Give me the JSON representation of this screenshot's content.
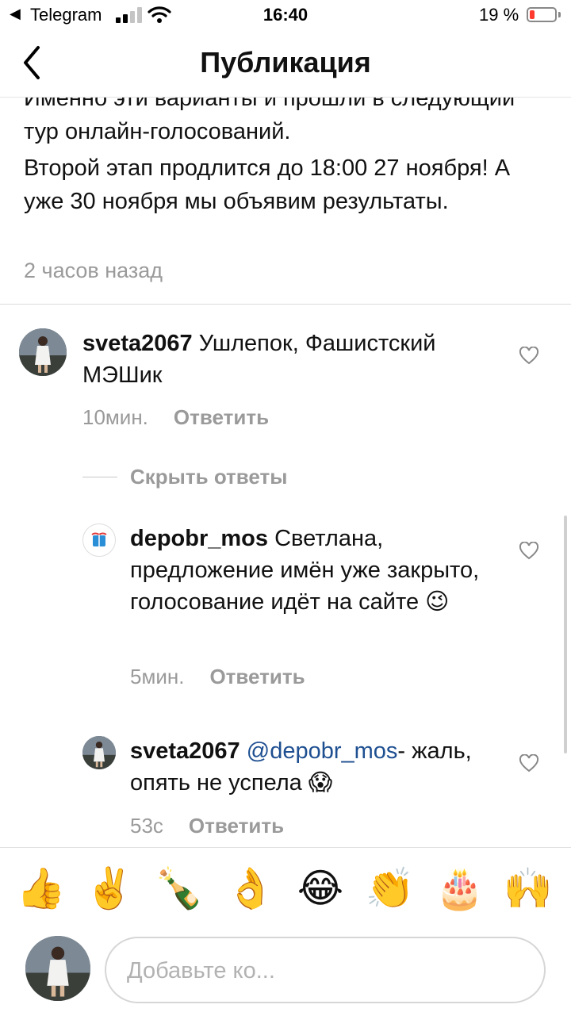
{
  "status_bar": {
    "back_arrow": "◀",
    "app": "Telegram",
    "time": "16:40",
    "battery": "19 %",
    "battery_level": 0.19,
    "battery_color": "#ff3b30"
  },
  "nav": {
    "title": "Публикация",
    "back_icon": "chevron-left-icon"
  },
  "post": {
    "caption_line1": "Именно эти варианты и прошли в следующий тур онлайн-голосований.",
    "caption_line2": "Второй этап продлится до 18:00 27 ноября! А уже 30 ноября мы объявим результаты.",
    "time": "2 часов назад"
  },
  "comments": [
    {
      "username": "sveta2067",
      "text": "Ушлепок, Фашистский МЭШик",
      "time": "10мин.",
      "reply_label": "Ответить"
    }
  ],
  "hide_replies_label": "Скрыть ответы",
  "replies": [
    {
      "username": "depobr_mos",
      "text": "Светлана, предложение имён уже закрыто, голосование идёт на сайте",
      "emoji": "😉",
      "time": "5мин.",
      "reply_label": "Ответить"
    },
    {
      "username": "sveta2067",
      "mention": "@depobr_mos",
      "text": "- жаль, опять не успела",
      "emoji": "😱",
      "time": "53с",
      "reply_label": "Ответить"
    }
  ],
  "emoji_bar": [
    "👍",
    "✌️",
    "🍾",
    "👌",
    "😂",
    "👏",
    "🎂",
    "🙌"
  ],
  "input": {
    "placeholder": "Добавьте ко..."
  },
  "colors": {
    "mention": "#1e4f91",
    "muted_text": "#9a9a9a"
  }
}
